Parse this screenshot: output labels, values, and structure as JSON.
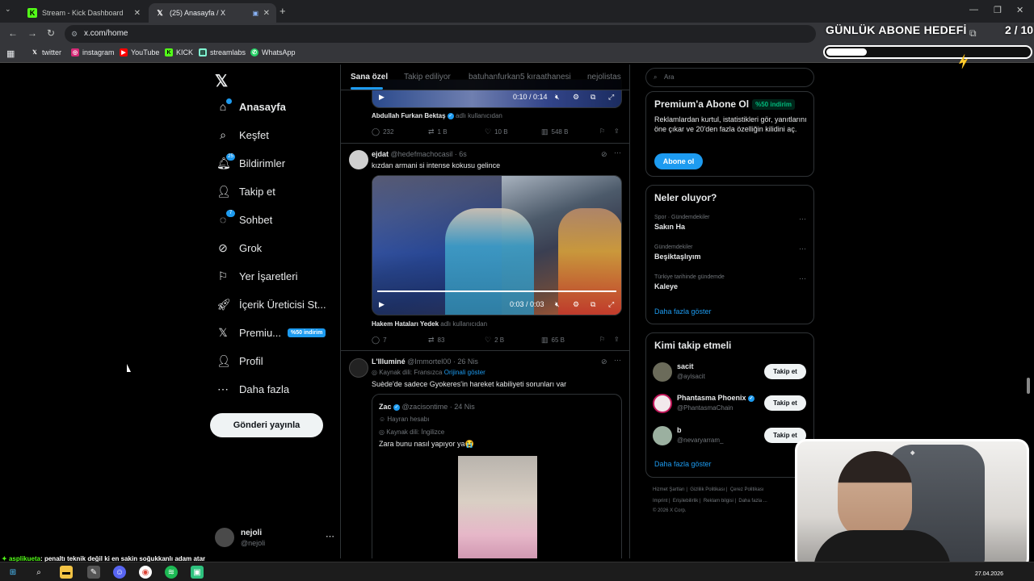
{
  "browser": {
    "tabs": [
      {
        "title": "Stream - Kick Dashboard",
        "icon": "kick-icon"
      },
      {
        "title": "(25) Anasayfa / X",
        "icon": "x-icon"
      }
    ],
    "url": "x.com/home",
    "bookmarks": [
      "twitter",
      "instagram",
      "YouTube",
      "KICK",
      "streamlabs",
      "WhatsApp"
    ]
  },
  "overlay": {
    "goal_title": "GÜNLÜK ABONE HEDEFİ",
    "goal_count": "2 / 10",
    "goal_progress": 0.2
  },
  "sidebar": {
    "items": [
      {
        "label": "Anasayfa",
        "icon": "home-icon"
      },
      {
        "label": "Keşfet",
        "icon": "search-icon"
      },
      {
        "label": "Bildirimler",
        "icon": "bell-icon",
        "badge": "25"
      },
      {
        "label": "Takip et",
        "icon": "follow-icon"
      },
      {
        "label": "Sohbet",
        "icon": "chat-icon",
        "badge": "7"
      },
      {
        "label": "Grok",
        "icon": "grok-icon"
      },
      {
        "label": "Yer İşaretleri",
        "icon": "bookmark-icon"
      },
      {
        "label": "İçerik Üreticisi St...",
        "icon": "rocket-icon"
      },
      {
        "label": "Premiu...",
        "icon": "x-premium-icon",
        "discount": "%50 indirim"
      },
      {
        "label": "Profil",
        "icon": "profile-icon"
      },
      {
        "label": "Daha fazla",
        "icon": "more-icon"
      }
    ],
    "post_button": "Gönderi yayınla",
    "account": {
      "name": "nejoli",
      "handle": "@nejoli"
    }
  },
  "main": {
    "tabs": [
      "Sana özel",
      "Takip ediliyor",
      "batuhanfurkan5 kıraathanesi",
      "nejolistas"
    ],
    "tweet0": {
      "video_time": "0:10 / 0:14",
      "source_name": "Abdullah Furkan Bektaş",
      "source_suffix": "adlı kullanıcıdan",
      "replies": "232",
      "reposts": "1 B",
      "likes": "10 B",
      "views": "548 B"
    },
    "tweet1": {
      "name": "ejdat",
      "handle": "@hedefmachocasil · 6s",
      "text": "kızdan armani si intense kokusu gelince",
      "video_time": "0:03 / 0:03",
      "source_name": "Hakem Hataları Yedek",
      "source_suffix": "adlı kullanıcıdan",
      "replies": "7",
      "reposts": "83",
      "likes": "2 B",
      "views": "65 B"
    },
    "tweet2": {
      "name": "L'Illuminé",
      "handle": "@Immortel00 · 26 Nis",
      "lang_note": "Kaynak dili: Fransızca",
      "lang_link": "Orijinali göster",
      "text": "Suède'de sadece Gyokeres'in hareket kabiliyeti sorunları var",
      "quote": {
        "name": "Zac",
        "handle": "@zacisontime · 24 Nis",
        "tag": "Hayran hesabı",
        "lang_note": "Kaynak dili: İngilizce",
        "text": "Zara bunu nasıl yapıyor ya😭"
      }
    }
  },
  "right": {
    "search_placeholder": "Ara",
    "premium": {
      "title": "Premium'a Abone Ol",
      "discount": "%50 indirim",
      "text": "Reklamlardan kurtul, istatistikleri gör, yanıtlarını öne çıkar ve 20'den fazla özelliğin kilidini aç.",
      "button": "Abone ol"
    },
    "trends": {
      "title": "Neler oluyor?",
      "items": [
        {
          "category": "Spor · Gündemdekiler",
          "topic": "Sakın Ha"
        },
        {
          "category": "Gündemdekiler",
          "topic": "Beşiktaşlıyım"
        },
        {
          "category": "Türkiye tarihinde gündemde",
          "topic": "Kaleye"
        }
      ],
      "show_more": "Daha fazla göster"
    },
    "who_to_follow": {
      "title": "Kimi takip etmeli",
      "items": [
        {
          "name": "sacit",
          "handle": "@ayisacit",
          "button": "Takip et"
        },
        {
          "name": "Phantasma Phoenix",
          "handle": "@PhantasmaChain",
          "button": "Takip et"
        },
        {
          "name": "b",
          "handle": "@nevaryarram_",
          "button": "Takip et"
        }
      ],
      "show_more": "Daha fazla göster"
    },
    "footer": [
      "Hizmet Şartları",
      "Gizlilik Politikası",
      "Çerez Politikası",
      "Imprint",
      "Erişilebilirlik",
      "Reklam bilgisi",
      "Daha fazla ...",
      "© 2026 X Corp."
    ]
  },
  "chat": {
    "user": "asplikueta",
    "message": ": penaltı teknik değil ki en sakin soğukkanlı adam atar"
  },
  "taskbar": {
    "date": "27.04.2026"
  },
  "colors": {
    "accent": "#1d9bf0",
    "kick": "#53fc18",
    "background": "#000000"
  }
}
